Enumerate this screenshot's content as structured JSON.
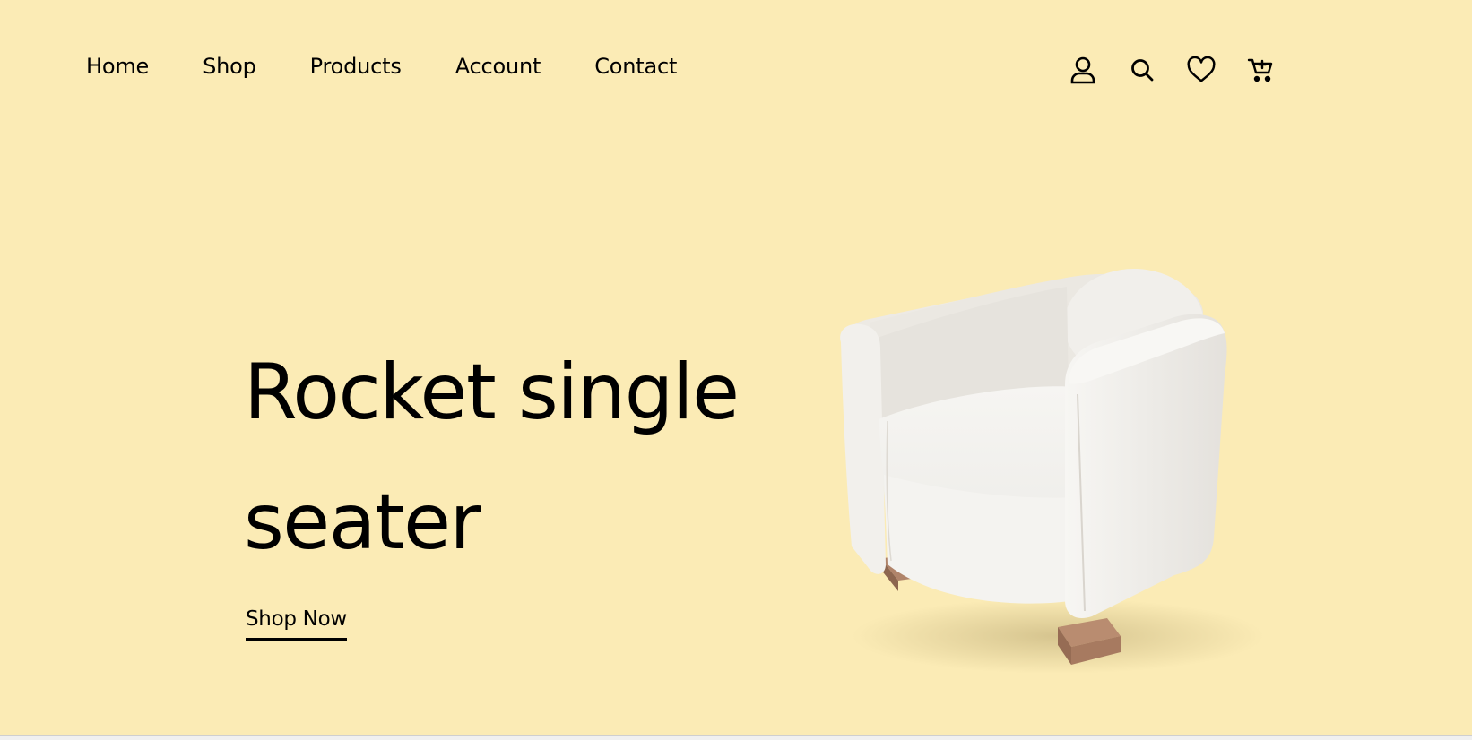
{
  "nav": {
    "items": [
      {
        "label": "Home"
      },
      {
        "label": "Shop"
      },
      {
        "label": "Products"
      },
      {
        "label": "Account"
      },
      {
        "label": "Contact"
      }
    ]
  },
  "header_icons": [
    "account-icon",
    "search-icon",
    "heart-icon",
    "cart-icon"
  ],
  "hero": {
    "title": "Rocket single seater",
    "cta_label": "Shop Now"
  },
  "colors": {
    "background": "#FBEBB5",
    "text": "#000000"
  }
}
